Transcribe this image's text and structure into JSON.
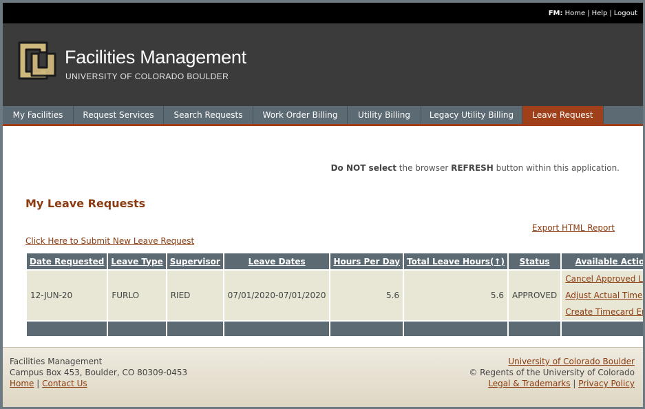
{
  "topbar": {
    "prefix": "FM:",
    "links": [
      "Home",
      "Help",
      "Logout"
    ]
  },
  "brand": {
    "title": "Facilities Management",
    "subtitle": "UNIVERSITY OF COLORADO BOULDER",
    "logo_colors": {
      "outline": "#1a1a1a",
      "fill": "#cfb87c"
    }
  },
  "nav": {
    "tabs": [
      {
        "label": "My Facilities",
        "active": false
      },
      {
        "label": "Request Services",
        "active": false
      },
      {
        "label": "Search Requests",
        "active": false
      },
      {
        "label": "Work Order Billing",
        "active": false
      },
      {
        "label": "Utility Billing",
        "active": false
      },
      {
        "label": "Legacy Utility Billing",
        "active": false
      },
      {
        "label": "Leave Request",
        "active": true
      }
    ]
  },
  "notice": {
    "bold1": "Do NOT select",
    "text1": " the browser ",
    "bold2": "REFRESH",
    "text2": " button within this application."
  },
  "main": {
    "title": "My Leave Requests",
    "export_link": "Export HTML Report",
    "submit_link": "Click Here to Submit New Leave Request"
  },
  "table": {
    "headers": [
      "Date Requested",
      "Leave Type",
      "Supervisor",
      "Leave Dates",
      "Hours Per Day",
      "Total Leave Hours(↑)",
      "Status",
      "Available Actions"
    ],
    "rows": [
      {
        "date_requested": "12-JUN-20",
        "leave_type": "FURLO",
        "supervisor": "RIED",
        "leave_dates": "07/01/2020-07/01/2020",
        "hours_per_day": "5.6",
        "total_hours": "5.6",
        "status": "APPROVED",
        "actions": [
          "Cancel Approved Leave",
          "Adjust Actual Time",
          "Create Timecard Entries"
        ]
      }
    ]
  },
  "footer": {
    "org": "Facilities Management",
    "address": "Campus Box 453, Boulder, CO 80309-0453",
    "home_link": "Home",
    "contact_link": "Contact Us",
    "university_link": "University of Colorado Boulder",
    "copyright": "© Regents of the University of Colorado",
    "legal_link": "Legal & Trademarks",
    "privacy_link": "Privacy Policy"
  },
  "colors": {
    "accent": "#a0401a",
    "nav_bg": "#5c6a73",
    "header_bg": "#3b3b3b",
    "row_bg": "#e8e6d4",
    "link": "#8a3b0f"
  }
}
